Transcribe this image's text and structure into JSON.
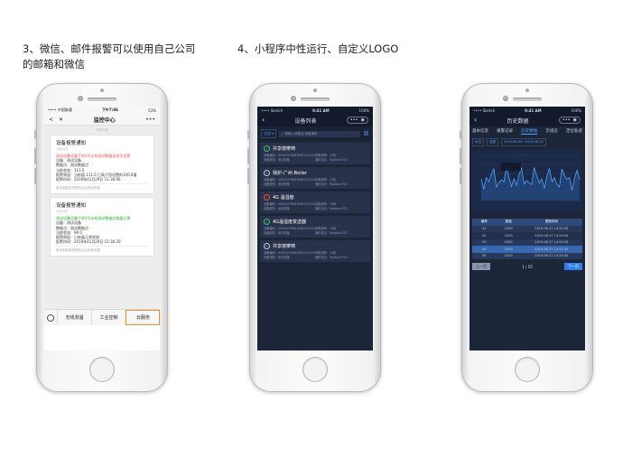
{
  "captions": {
    "left": "3、微信、邮件报警可以使用自己公司的邮箱和微信",
    "right": "4、小程序中性运行、自定义LOGO"
  },
  "phone1": {
    "status_left": "•••• 中国联通",
    "status_time": "下午7:06",
    "status_right": "53%",
    "nav_title": "监控中心",
    "back": "<",
    "close": "✕",
    "more": "•••",
    "cards": [
      {
        "title": "设备报警通知",
        "date": "1月29日",
        "alert": "测试设备设备下的1号水机测试数据点发生告警",
        "lines": [
          "设备：测试设备",
          "数据点：测试数据点",
          "当前状态：111.0",
          "报警原因：当前值 111.0 已高于您设置的100.0值",
          "报警时间：2019年01月29日 11:36:06"
        ],
        "foot": "更详细信息请登陆后台系统查看"
      },
      {
        "title": "设备报警通知",
        "date": "1月29日",
        "alert": "测试设备设备下的1号水机测试数据点恢复正常",
        "lines": [
          "设备：测试设备",
          "数据点：测试数据点",
          "当前状态：99.0",
          "报警原因：已恢复正常状态",
          "报警时间：2019年01月29日 11:36:20"
        ],
        "foot": "更详细信息请登陆后台系统查看"
      }
    ],
    "menu": [
      "无线测温",
      "工业控制",
      "云服务"
    ]
  },
  "phone2": {
    "status_left": "•••• Sketch",
    "status_time": "9:41 AM",
    "status_right": "100%",
    "nav_title": "设备列表",
    "filter": "全部",
    "search_placeholder": "请输入设备名/设备编码",
    "devices": [
      {
        "name": "共享按摩椅",
        "state": "ok",
        "code": "设备编码：000000298816983120208",
        "prot": "采集频率：10秒",
        "type": "设备类型：测试设备",
        "proto": "通讯协议：Modbus RTU"
      },
      {
        "name": "锅炉-广州-Boiler",
        "state": "off",
        "code": "设备编码：000000298816983120208",
        "prot": "采集频率：10秒",
        "type": "设备类型：测试设备",
        "proto": "通讯协议：Modbus RTU"
      },
      {
        "name": "4G 温湿度",
        "state": "alarm",
        "code": "设备编码：000000298816983120208",
        "prot": "采集频率：10秒",
        "type": "设备类型：测试设备",
        "proto": "通讯协议：Modbus RTU"
      },
      {
        "name": "4G温湿度变送器",
        "state": "ok",
        "code": "设备编码：000000298816983120208",
        "prot": "采集频率：10秒",
        "type": "设备类型：测试设备",
        "proto": "通讯协议：Modbus RTU"
      },
      {
        "name": "共享按摩椅",
        "state": "off",
        "code": "设备编码：000000298816983120208",
        "prot": "采集频率：10秒",
        "type": "设备类型：测试设备",
        "proto": "通讯协议：Modbus RTU"
      }
    ]
  },
  "phone3": {
    "status_left": "•••• Sketch",
    "status_time": "9:41 AM",
    "status_right": "100%",
    "nav_title": "历史数据",
    "tabs": [
      "基本信息",
      "报警记录",
      "历史数据",
      "云组态",
      "定位轨迹"
    ],
    "filters": [
      "水位",
      "全部",
      "2019-06-05~2019-06-10"
    ],
    "table_head": [
      "编号",
      "数值",
      "更新时间"
    ],
    "rows": [
      [
        "01",
        "1000",
        "2019-06-27 14:20:30"
      ],
      [
        "02",
        "1000",
        "2019-06-27 14:20:30"
      ],
      [
        "03",
        "1000",
        "2019-06-27 14:20:30"
      ],
      [
        "04",
        "1000",
        "2019-06-27 14:20:30"
      ],
      [
        "05",
        "1000",
        "2019-06-27 14:20:30"
      ]
    ],
    "prev": "上一页",
    "page": "1 / 15",
    "next": "下一页",
    "chart_colors": {
      "line": "#4ea3ff",
      "area": "#2a5a9a"
    }
  }
}
